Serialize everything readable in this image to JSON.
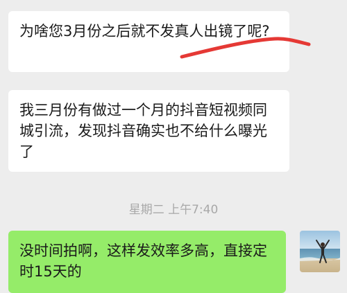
{
  "colors": {
    "background": "#ededed",
    "incoming_bubble": "#ffffff",
    "outgoing_bubble": "#95ec69",
    "annotation_stroke": "#e53935",
    "timestamp_text": "#a8a8a8"
  },
  "messages": [
    {
      "direction": "incoming",
      "text": "为啥您3月份之后就不发真人出镜了呢?"
    },
    {
      "direction": "incoming",
      "text": "我三月份有做过一个月的抖音短视频同城引流，发现抖音确实也不给什么曝光了"
    },
    {
      "direction": "outgoing",
      "text": "没时间拍啊，这样发效率多高，直接定时15天的"
    }
  ],
  "timestamp": "星期二 上午7:40",
  "avatar": {
    "icon": "beach-person-avatar"
  },
  "annotation": {
    "icon": "red-underline-stroke"
  }
}
